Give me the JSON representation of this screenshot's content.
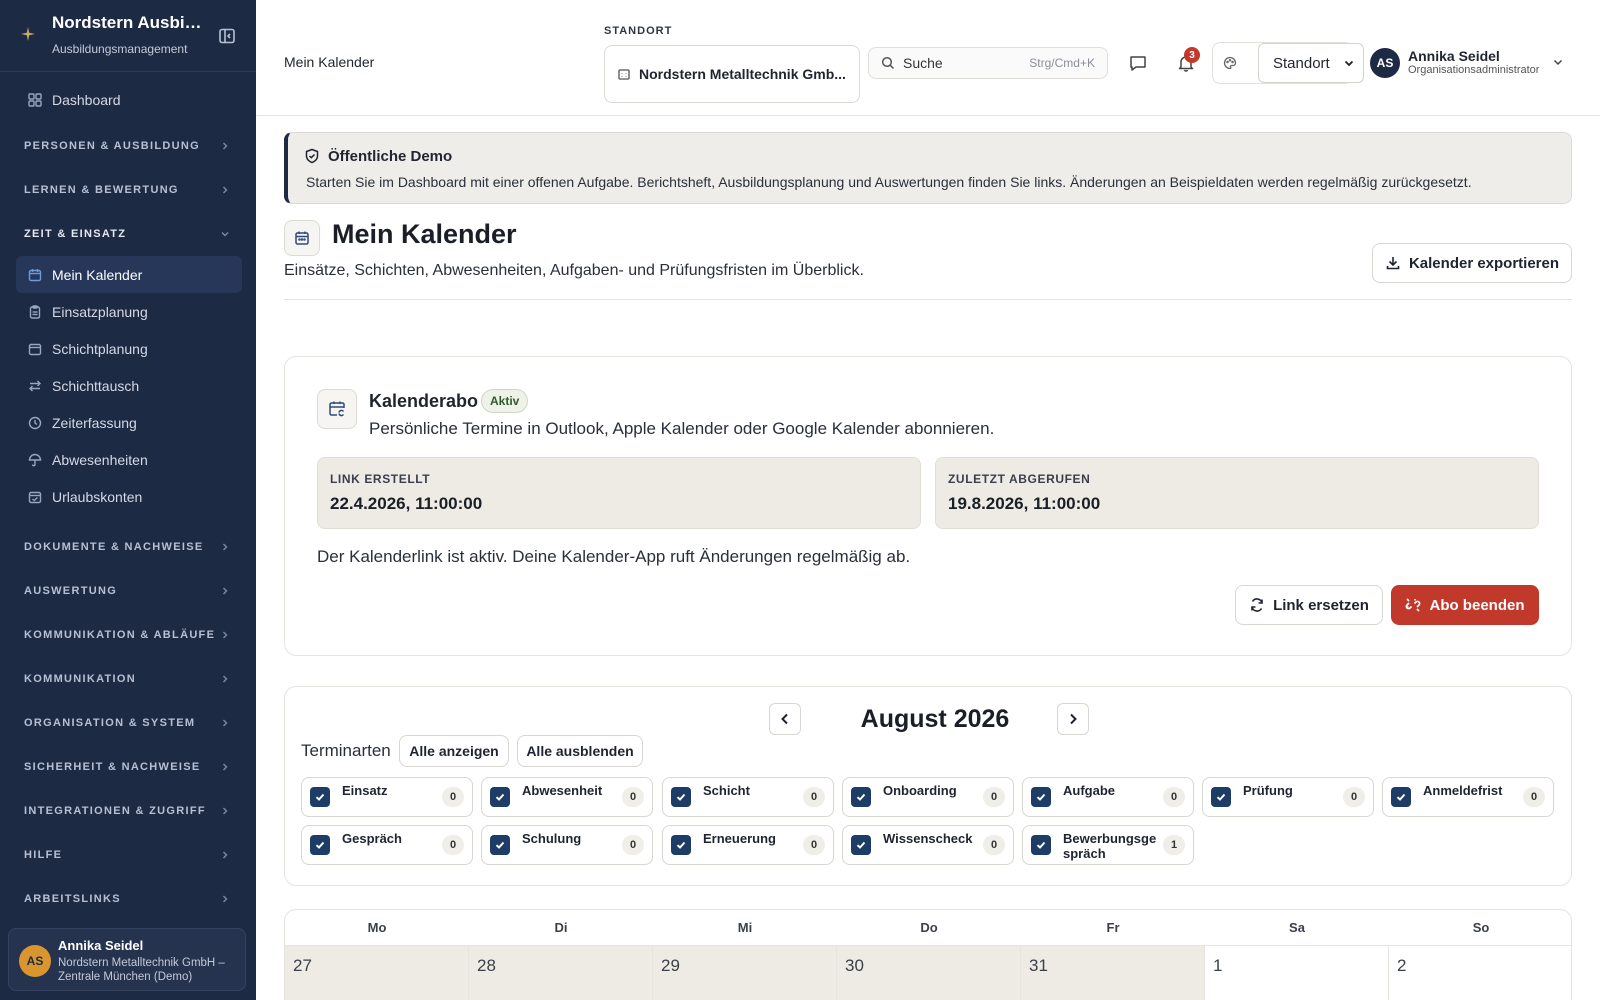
{
  "sidebar": {
    "org_name": "Nordstern Ausbil...",
    "org_sub": "Ausbildungsmanagement",
    "dashboard": "Dashboard",
    "groups": {
      "personen": "PERSONEN & AUSBILDUNG",
      "lernen": "LERNEN & BEWERTUNG",
      "zeit": "ZEIT & EINSATZ",
      "dokumente": "DOKUMENTE & NACHWEISE",
      "auswertung": "AUSWERTUNG",
      "komm_ablaeufe": "KOMMUNIKATION & ABLÄUFE",
      "kommunikation": "KOMMUNIKATION",
      "organisation": "ORGANISATION & SYSTEM",
      "sicherheit": "SICHERHEIT & NACHWEISE",
      "integrationen": "INTEGRATIONEN & ZUGRIFF",
      "hilfe": "HILFE",
      "arbeitslinks": "ARBEITSLINKS"
    },
    "zeit_items": [
      "Mein Kalender",
      "Einsatzplanung",
      "Schichtplanung",
      "Schichttausch",
      "Zeiterfassung",
      "Abwesenheiten",
      "Urlaubskonten"
    ],
    "user": {
      "initials": "AS",
      "name": "Annika Seidel",
      "location": "Nordstern Metalltechnik GmbH – Zentrale München (Demo)"
    }
  },
  "topbar": {
    "title": "Mein Kalender",
    "standort_label": "STANDORT",
    "standort_value": "Nordstern Metalltechnik Gmb...",
    "search_placeholder": "Suche",
    "search_shortcut": "Strg/Cmd+K",
    "notification_count": "3",
    "select_value": "Standort",
    "user_initials": "AS",
    "user_name": "Annika Seidel",
    "user_role": "Organisationsadministrator"
  },
  "demo": {
    "title": "Öffentliche Demo",
    "text": "Starten Sie im Dashboard mit einer offenen Aufgabe. Berichtsheft, Ausbildungsplanung und Auswertungen finden Sie links. Änderungen an Beispieldaten werden regelmäßig zurückgesetzt."
  },
  "page": {
    "title": "Mein Kalender",
    "subtitle": "Einsätze, Schichten, Abwesenheiten, Aufgaben- und Prüfungsfristen im Überblick.",
    "export_label": "Kalender exportieren"
  },
  "abo": {
    "title": "Kalenderabo",
    "badge": "Aktiv",
    "subtitle": "Persönliche Termine in Outlook, Apple Kalender oder Google Kalender abonnieren.",
    "created_label": "LINK ERSTELLT",
    "created_value": "22.4.2026, 11:00:00",
    "accessed_label": "ZULETZT ABGERUFEN",
    "accessed_value": "19.8.2026, 11:00:00",
    "info": "Der Kalenderlink ist aktiv. Deine Kalender-App ruft Änderungen regelmäßig ab.",
    "replace_label": "Link ersetzen",
    "end_label": "Abo beenden"
  },
  "calendar": {
    "month": "August 2026",
    "types_label": "Terminarten",
    "show_all": "Alle anzeigen",
    "hide_all": "Alle ausblenden",
    "types": [
      {
        "label": "Einsatz",
        "count": "0"
      },
      {
        "label": "Abwesenheit",
        "count": "0"
      },
      {
        "label": "Schicht",
        "count": "0"
      },
      {
        "label": "Onboarding",
        "count": "0"
      },
      {
        "label": "Aufgabe",
        "count": "0"
      },
      {
        "label": "Prüfung",
        "count": "0"
      },
      {
        "label": "Anmeldefrist",
        "count": "0"
      },
      {
        "label": "Gespräch",
        "count": "0"
      },
      {
        "label": "Schulung",
        "count": "0"
      },
      {
        "label": "Erneuerung",
        "count": "0"
      },
      {
        "label": "Wissenscheck",
        "count": "0"
      },
      {
        "label": "Bewerbungsgespräch",
        "count": "1"
      }
    ],
    "weekdays": [
      "Mo",
      "Di",
      "Mi",
      "Do",
      "Fr",
      "Sa",
      "So"
    ],
    "first_week": [
      "27",
      "28",
      "29",
      "30",
      "31",
      "1",
      "2"
    ]
  },
  "colors": {
    "sidebar_bg": "#1d2a44",
    "accent_danger": "#c0392b",
    "checkbox": "#1d3d66",
    "avatar_orange": "#d9962f"
  },
  "icons": {
    "logo": "sparkle-icon",
    "collapse": "sidebar-collapse-icon",
    "search": "search-icon",
    "chat": "chat-icon",
    "bell": "bell-icon",
    "theme": "palette-icon",
    "export": "download-icon",
    "shield": "shield-check-icon"
  }
}
